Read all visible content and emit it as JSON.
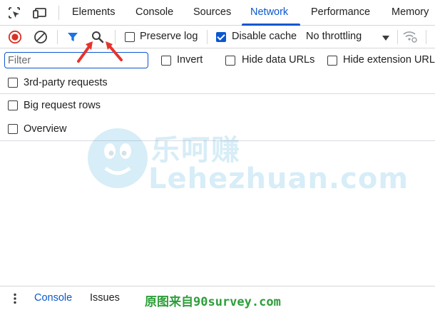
{
  "tabs": [
    {
      "label": "Elements",
      "active": false
    },
    {
      "label": "Console",
      "active": false
    },
    {
      "label": "Sources",
      "active": false
    },
    {
      "label": "Network",
      "active": true
    },
    {
      "label": "Performance",
      "active": false
    },
    {
      "label": "Memory",
      "active": false
    }
  ],
  "toolbar": {
    "preserve_log": {
      "label": "Preserve log",
      "checked": false
    },
    "disable_cache": {
      "label": "Disable cache",
      "checked": true
    },
    "throttling": "No throttling"
  },
  "filter": {
    "placeholder": "Filter",
    "invert": {
      "label": "Invert",
      "checked": false
    },
    "hide_data_urls": {
      "label": "Hide data URLs",
      "checked": false
    },
    "hide_extension_urls": {
      "label": "Hide extension URLs",
      "checked": false
    }
  },
  "options": [
    {
      "label": "3rd-party requests",
      "checked": false
    },
    {
      "label": "Big request rows",
      "checked": false
    },
    {
      "label": "Overview",
      "checked": false
    }
  ],
  "watermark": {
    "cn": "乐呵赚",
    "en": "Lehezhuan.com"
  },
  "drawer": {
    "tabs": [
      {
        "label": "Console",
        "active": true
      },
      {
        "label": "Issues",
        "active": false
      }
    ]
  },
  "footer_watermark": "原图来自90survey.com",
  "colors": {
    "accent": "#0b57d0",
    "record_red": "#d93025",
    "annotation_arrow": "#e8332a",
    "footer_watermark": "#2e9e3a"
  }
}
